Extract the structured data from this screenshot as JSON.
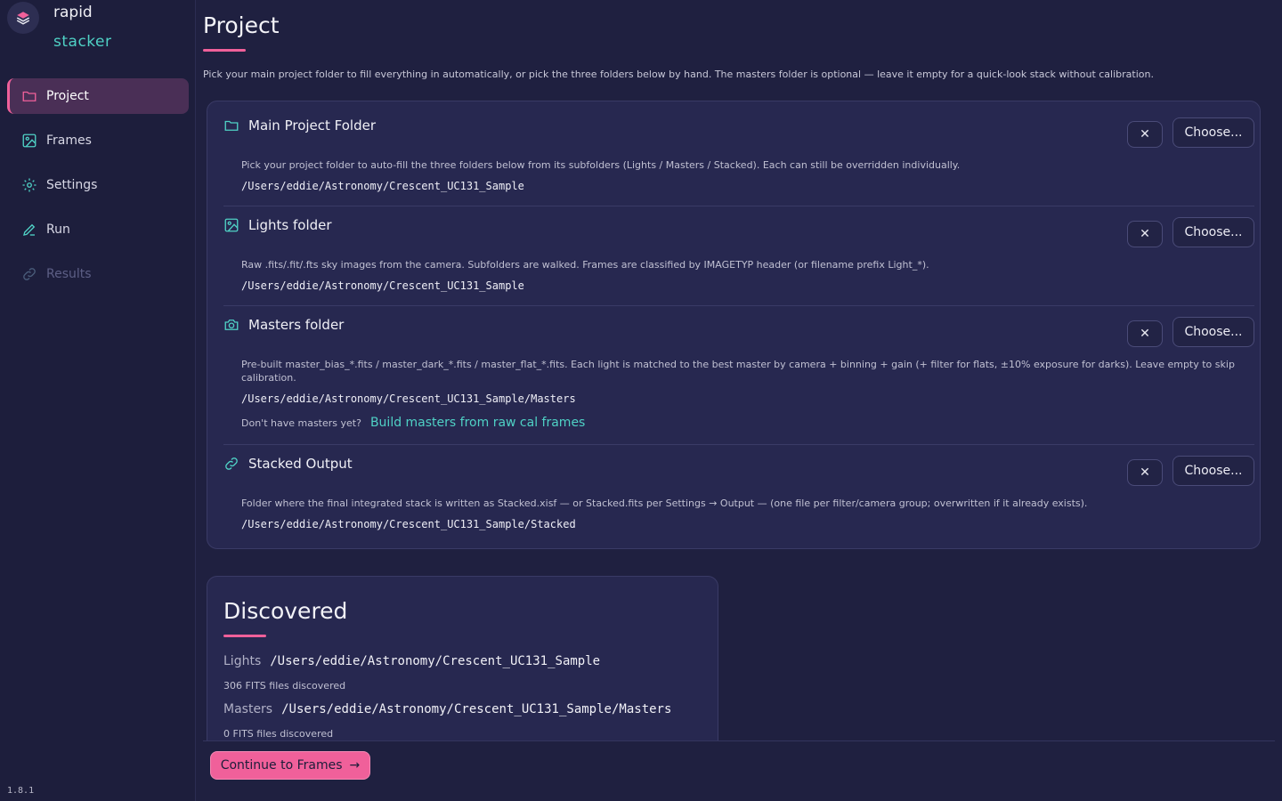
{
  "app": {
    "name_line1": "rapid",
    "name_line2": "stacker",
    "version": "1.8.1"
  },
  "colors": {
    "accent": "#f0609a",
    "teal": "#4fd1c5",
    "background": "#1f2040",
    "card": "#272850"
  },
  "sidebar": {
    "items": [
      {
        "label": "Project",
        "icon": "folder-icon",
        "active": true
      },
      {
        "label": "Frames",
        "icon": "image-icon"
      },
      {
        "label": "Settings",
        "icon": "gear-icon"
      },
      {
        "label": "Run",
        "icon": "pen-icon"
      },
      {
        "label": "Results",
        "icon": "link-icon",
        "disabled": true
      }
    ]
  },
  "main": {
    "title": "Project",
    "intro": "Pick your main project folder to fill everything in automatically, or pick the three folders below by hand. The masters folder is optional — leave it empty for a quick-look stack without calibration."
  },
  "folders": [
    {
      "title": "Main Project Folder",
      "icon": "folder-icon",
      "description": "Pick your project folder to auto-fill the three folders below from its subfolders (Lights / Masters / Stacked). Each can still be overridden individually.",
      "path": "/Users/eddie/Astronomy/Crescent_UC131_Sample",
      "clear_label": "✕",
      "choose_label": "Choose..."
    },
    {
      "title": "Lights folder",
      "icon": "image-icon",
      "description": "Raw .fits/.fit/.fts sky images from the camera. Subfolders are walked. Frames are classified by IMAGETYP header (or filename prefix Light_*).",
      "path": "/Users/eddie/Astronomy/Crescent_UC131_Sample",
      "clear_label": "✕",
      "choose_label": "Choose..."
    },
    {
      "title": "Masters folder",
      "icon": "camera-icon",
      "description": "Pre-built master_bias_*.fits / master_dark_*.fits / master_flat_*.fits. Each light is matched to the best master by camera + binning + gain (+ filter for flats, ±10% exposure for darks). Leave empty to skip calibration.",
      "path": "/Users/eddie/Astronomy/Crescent_UC131_Sample/Masters",
      "hint": "Don't have masters yet?",
      "link": "Build masters from raw cal frames",
      "clear_label": "✕",
      "choose_label": "Choose..."
    },
    {
      "title": "Stacked Output",
      "icon": "link-icon",
      "description": "Folder where the final integrated stack is written as Stacked.xisf — or Stacked.fits per Settings → Output — (one file per filter/camera group; overwritten if it already exists).",
      "path": "/Users/eddie/Astronomy/Crescent_UC131_Sample/Stacked",
      "clear_label": "✕",
      "choose_label": "Choose..."
    }
  ],
  "discovered": {
    "title": "Discovered",
    "lights_label": "Lights",
    "lights_path": "/Users/eddie/Astronomy/Crescent_UC131_Sample",
    "lights_count": "306 FITS files discovered",
    "masters_label": "Masters",
    "masters_path": "/Users/eddie/Astronomy/Crescent_UC131_Sample/Masters",
    "masters_count": "0 FITS files discovered"
  },
  "footer": {
    "continue_label": "Continue to Frames",
    "continue_icon": "arrow-right-icon"
  }
}
